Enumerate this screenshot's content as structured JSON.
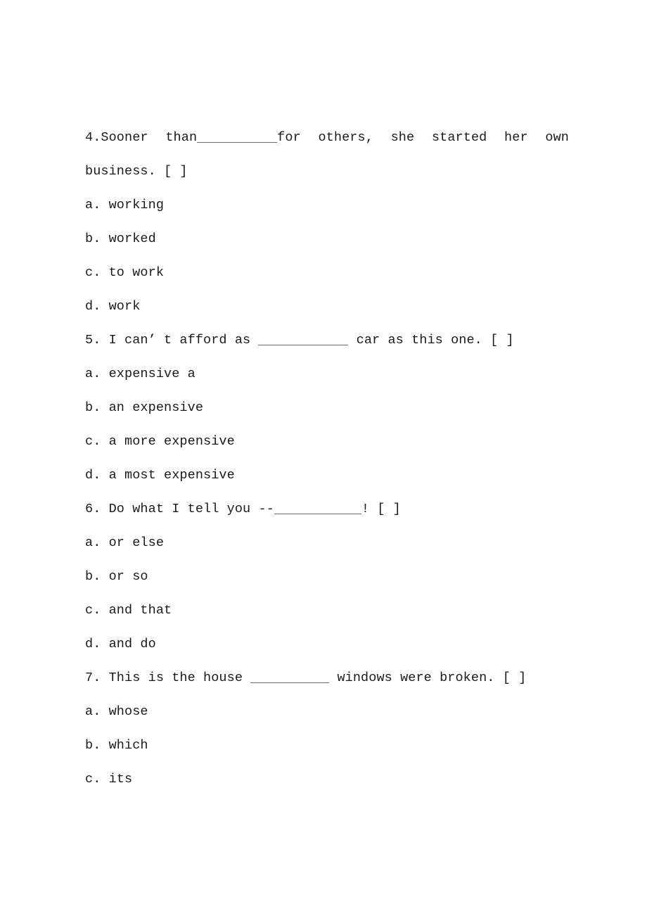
{
  "document": {
    "type": "english-grammar-multiple-choice-worksheet",
    "page_background": "#ffffff",
    "text_color": "#1a1a1a",
    "blank_rule_color": "#6b6b6b"
  },
  "questions": [
    {
      "number": "4.",
      "stem_part1": "Sooner  than",
      "blank_width_class": "w4",
      "stem_part2": "for  others,  she  started  her  own",
      "stem_line2": "business. [ ]",
      "marker": "[ ]",
      "options": [
        {
          "letter": "a.",
          "text": "working"
        },
        {
          "letter": "b.",
          "text": "worked"
        },
        {
          "letter": "c.",
          "text": "to work"
        },
        {
          "letter": "d.",
          "text": "work"
        }
      ]
    },
    {
      "number": "5.",
      "stem_part1": "I can’ t afford as ",
      "blank_width_class": "w5",
      "stem_part2": " car as this one. [ ]",
      "marker": "[ ]",
      "options": [
        {
          "letter": "a.",
          "text": "expensive a"
        },
        {
          "letter": "b.",
          "text": "an expensive"
        },
        {
          "letter": "c.",
          "text": "a more expensive"
        },
        {
          "letter": "d.",
          "text": "a most expensive"
        }
      ]
    },
    {
      "number": "6.",
      "stem_part1": "Do what I tell you --",
      "blank_width_class": "w6",
      "stem_part2": "! [ ]",
      "marker": "[ ]",
      "options": [
        {
          "letter": "a.",
          "text": "or else"
        },
        {
          "letter": "b.",
          "text": "or so"
        },
        {
          "letter": "c.",
          "text": "and that"
        },
        {
          "letter": "d.",
          "text": "and do"
        }
      ]
    },
    {
      "number": "7.",
      "stem_part1": "This is the house ",
      "blank_width_class": "w7",
      "stem_part2": " windows were broken. [ ]",
      "marker": "[ ]",
      "options": [
        {
          "letter": "a.",
          "text": "whose"
        },
        {
          "letter": "b.",
          "text": "which"
        },
        {
          "letter": "c.",
          "text": "its"
        }
      ]
    }
  ]
}
